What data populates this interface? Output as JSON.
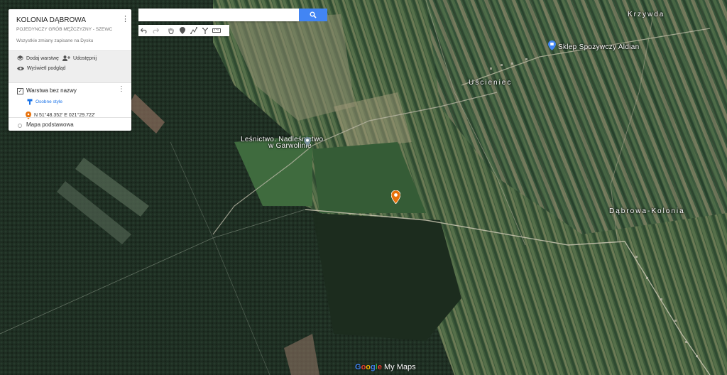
{
  "panel": {
    "title": "KOLONIA DĄBROWA",
    "subtitle": "POJEDYNCZY GRÓB MĘŻCZYZNY - SZEWC",
    "saved_status": "Wszystkie zmiany zapisane na Dysku",
    "add_layer": "Dodaj warstwę",
    "share": "Udostępnij",
    "preview": "Wyświetl podgląd",
    "layer_name": "Warstwa bez nazwy",
    "layer_style": "Osobne style",
    "point_label": "N 51°48.352' E 021°29.722'",
    "base_map": "Mapa podstawowa"
  },
  "search": {
    "placeholder": "",
    "value": ""
  },
  "map_labels": {
    "krzywda": "Krzywda",
    "shop": "Sklep Spożywczy Aldian",
    "uscieniec": "Uścieniec",
    "forestry_line1": "Leśnictwo. Nadleśnictwo",
    "forestry_line2": "w Garwolinie",
    "dabrowa": "Dąbrowa-Kolonia"
  },
  "footer": {
    "logo_google": "Google",
    "logo_product": "My Maps"
  },
  "colors": {
    "accent_blue": "#4285f4",
    "pin_orange": "#e8710a",
    "link_blue": "#1a73e8"
  },
  "icons": [
    "search-icon",
    "undo-icon",
    "redo-icon",
    "hand-icon",
    "marker-icon",
    "line-icon",
    "directions-icon",
    "ruler-icon",
    "layers-icon",
    "share-icon",
    "eye-icon",
    "paint-icon",
    "pin-icon"
  ]
}
